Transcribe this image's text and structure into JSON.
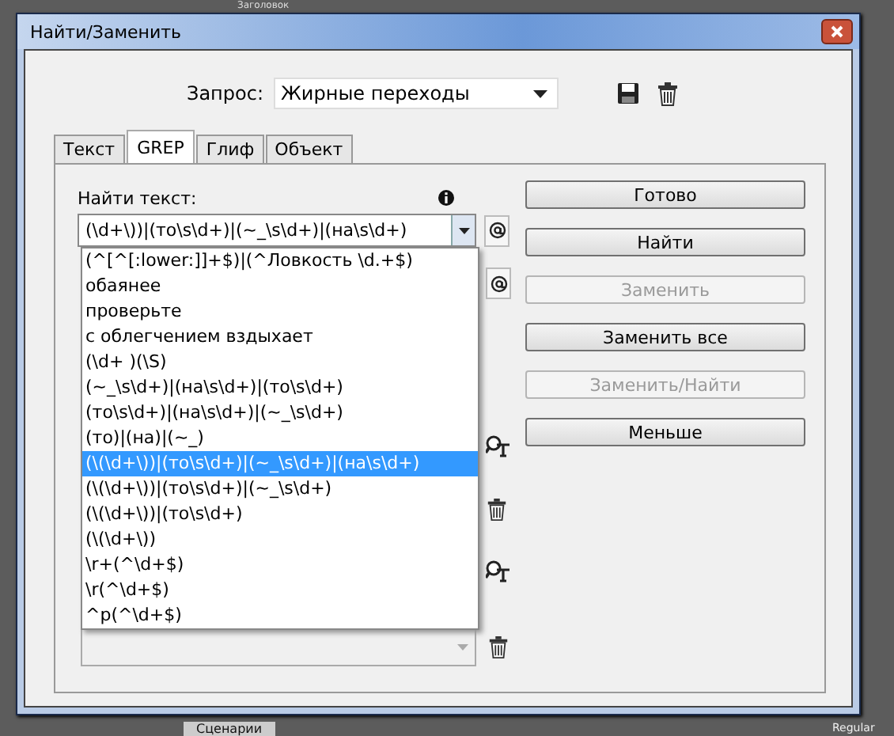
{
  "background": {
    "top_label": "Заголовок",
    "bottom_tab": "Сценарии",
    "font_style": "Regular"
  },
  "window": {
    "title": "Найти/Заменить"
  },
  "query": {
    "label": "Запрос:",
    "value": "Жирные переходы"
  },
  "tabs": [
    {
      "label": "Текст",
      "selected": false
    },
    {
      "label": "GREP",
      "selected": true
    },
    {
      "label": "Глиф",
      "selected": false
    },
    {
      "label": "Объект",
      "selected": false
    }
  ],
  "find": {
    "label": "Найти текст:",
    "value": "(\\d+\\))|(то\\s\\d+)|(~_\\s\\d+)|(на\\s\\d+)"
  },
  "dropdown": [
    {
      "text": "(^[^[:lower:]]+$)|(^Ловкость \\d.+$)",
      "selected": false
    },
    {
      "text": "обаянее",
      "selected": false
    },
    {
      "text": "проверьте",
      "selected": false
    },
    {
      "text": "с облегчением вздыхает",
      "selected": false
    },
    {
      "text": "(\\d+ )(\\S)",
      "selected": false
    },
    {
      "text": "(~_\\s\\d+)|(на\\s\\d+)|(то\\s\\d+)",
      "selected": false
    },
    {
      "text": "(то\\s\\d+)|(на\\s\\d+)|(~_\\s\\d+)",
      "selected": false
    },
    {
      "text": "(то)|(на)|(~_)",
      "selected": false
    },
    {
      "text": "(\\(\\d+\\))|(то\\s\\d+)|(~_\\s\\d+)|(на\\s\\d+)",
      "selected": true
    },
    {
      "text": "(\\(\\d+\\))|(то\\s\\d+)|(~_\\s\\d+)",
      "selected": false
    },
    {
      "text": "(\\(\\d+\\))|(то\\s\\d+)",
      "selected": false
    },
    {
      "text": "(\\(\\d+\\))",
      "selected": false
    },
    {
      "text": "\\r+(^\\d+$)",
      "selected": false
    },
    {
      "text": "\\r(^\\d+$)",
      "selected": false
    },
    {
      "text": "^p(^\\d+$)",
      "selected": false
    }
  ],
  "buttons": [
    {
      "label": "Готово",
      "disabled": false
    },
    {
      "label": "Найти",
      "disabled": false
    },
    {
      "label": "Заменить",
      "disabled": true
    },
    {
      "label": "Заменить все",
      "disabled": false
    },
    {
      "label": "Заменить/Найти",
      "disabled": true
    },
    {
      "label": "Меньше",
      "disabled": false
    }
  ]
}
